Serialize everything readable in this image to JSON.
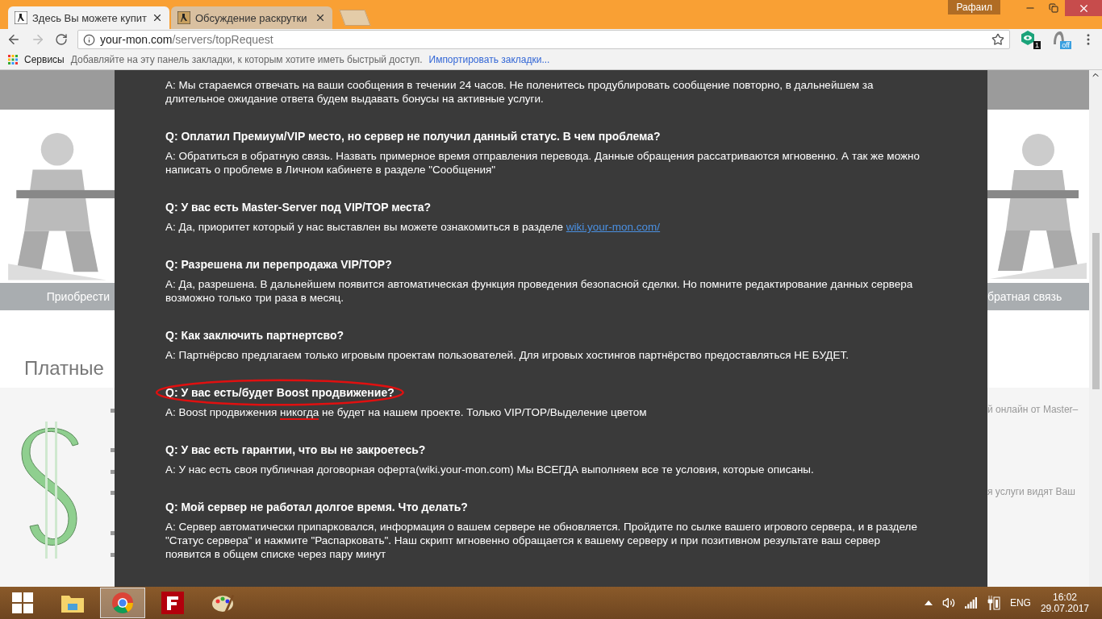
{
  "browser": {
    "tabs": [
      {
        "title": "Здесь Вы можете купит",
        "selected": true
      },
      {
        "title": "Обсуждение раскрутки",
        "selected": false
      }
    ],
    "profile": "Рафаил",
    "url_host": "your-mon.com",
    "url_path": "/servers/topRequest",
    "extension_badges": [
      "1",
      "off"
    ],
    "bookmarks": {
      "apps_label": "Сервисы",
      "hint": "Добавляйте на эту панель закладки, к которым хотите иметь быстрый доступ.",
      "import_link": "Импортировать закладки..."
    }
  },
  "page": {
    "left_nav": "Приобрести",
    "right_nav": "братная связь",
    "heading": "Платные",
    "right_texts": [
      "й онлайн от Master–",
      "я услуги видят Ваш"
    ]
  },
  "faq": [
    {
      "circled": false,
      "answer": [
        {
          "kind": "text",
          "text": "A: Мы стараемся отвечать на ваши сообщения в течении 24 часов. Не поленитесь продублировать сообщение повторно, в дальнейшем за длительное ожидание ответа будем выдавать бонусы на активные услуги."
        }
      ]
    },
    {
      "question": "Q: Оплатил Премиум/VIP место, но сервер не получил данный статус. В чем проблема?",
      "circled": false,
      "answer": [
        {
          "kind": "text",
          "text": "A: Обратиться в обратную связь. Назвать примерное время отправления перевода. Данные обращения рассатриваются мгновенно. А так же можно написать о проблеме в Личном кабинете в разделе \"Сообщения\""
        }
      ]
    },
    {
      "question": "Q: У вас есть Master-Server под VIP/TOP места?",
      "circled": false,
      "answer": [
        {
          "kind": "text",
          "text": "A: Да, приоритет который у нас выставлен вы можете ознакомиться в разделе "
        },
        {
          "kind": "link",
          "text": "wiki.your-mon.com/"
        }
      ]
    },
    {
      "question": "Q: Разрешена ли перепродажа VIP/TOP?",
      "circled": false,
      "answer": [
        {
          "kind": "text",
          "text": "A: Да, разрешена. В дальнейшем появится автоматическая функция проведения безопасной сделки. Но помните редактирование данных сервера возможно только три раза в месяц."
        }
      ]
    },
    {
      "question": "Q: Как заключить партнертсво?",
      "circled": false,
      "answer": [
        {
          "kind": "text",
          "text": "A: Партнёрсво предлагаем только игровым проектам пользователей. Для игровых хостингов партнёрство предоставляться НЕ БУДЕТ."
        }
      ]
    },
    {
      "question": "Q: У вас есть/будет Boost продвижение?",
      "circled": true,
      "answer": [
        {
          "kind": "text",
          "text": "A: Boost продвижения "
        },
        {
          "kind": "underlined",
          "text": "никогда"
        },
        {
          "kind": "text",
          "text": " не будет на нашем проекте. Только VIP/TOP/Выделение цветом"
        }
      ]
    },
    {
      "question": "Q: У вас есть гарантии, что вы не закроетесь?",
      "circled": false,
      "answer": [
        {
          "kind": "text",
          "text": "A: У нас есть своя публичная договорная оферта(wiki.your-mon.com) Мы ВСЕГДА выполняем все те условия, которые описаны."
        }
      ]
    },
    {
      "question": "Q: Мой сервер не работал долгое время. Что делать?",
      "circled": false,
      "answer": [
        {
          "kind": "text",
          "text": "A: Сервер автоматически припарковался, информация о вашем сервере не обновляется. Пройдите по сылке вашего игрового сервера, и в разделе \"Статус сервера\" и нажмите \"Распарковать\". Наш скрипт мгновенно обращается к вашему серверу и при позитивном результате ваш сервер появится в общем списке через пару минут"
        }
      ]
    }
  ],
  "taskbar": {
    "apps": [
      {
        "kind": "explorer",
        "selected": false
      },
      {
        "kind": "chrome",
        "selected": true
      },
      {
        "kind": "filezilla",
        "selected": false
      },
      {
        "kind": "paint",
        "selected": false
      }
    ],
    "lang": "ENG",
    "time": "16:02",
    "date": "29.07.2017"
  }
}
